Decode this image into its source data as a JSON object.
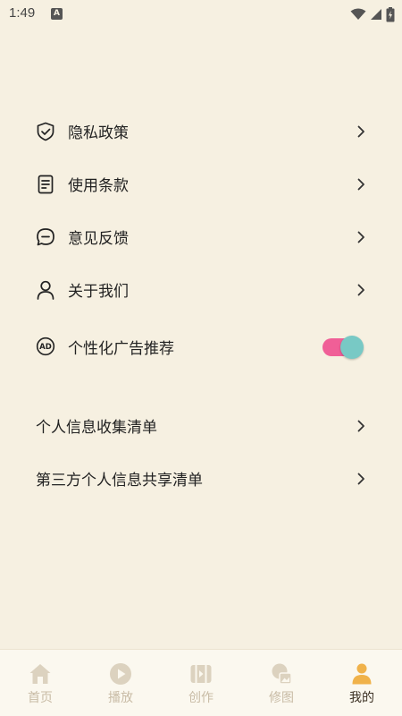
{
  "status_bar": {
    "time": "1:49",
    "notification_letter": "A"
  },
  "menu": {
    "items": [
      {
        "label": "隐私政策",
        "icon": "shield-check-icon"
      },
      {
        "label": "使用条款",
        "icon": "document-icon"
      },
      {
        "label": "意见反馈",
        "icon": "chat-bubble-icon"
      },
      {
        "label": "关于我们",
        "icon": "person-icon"
      },
      {
        "label": "个性化广告推荐",
        "icon": "ad-icon",
        "toggle_on": true
      }
    ]
  },
  "menu2": {
    "items": [
      {
        "label": "个人信息收集清单"
      },
      {
        "label": "第三方个人信息共享清单"
      }
    ]
  },
  "tabbar": {
    "tabs": [
      {
        "label": "首页",
        "icon": "home-icon"
      },
      {
        "label": "播放",
        "icon": "play-icon"
      },
      {
        "label": "创作",
        "icon": "video-clip-icon"
      },
      {
        "label": "修图",
        "icon": "image-edit-icon"
      },
      {
        "label": "我的",
        "icon": "user-profile-icon",
        "active": true
      }
    ]
  },
  "colors": {
    "background": "#f6f0e1",
    "toggle_track": "#f05f97",
    "toggle_knob": "#78c9c5",
    "tab_inactive": "#c8bba5",
    "tab_active_icon": "#f0b24a"
  }
}
